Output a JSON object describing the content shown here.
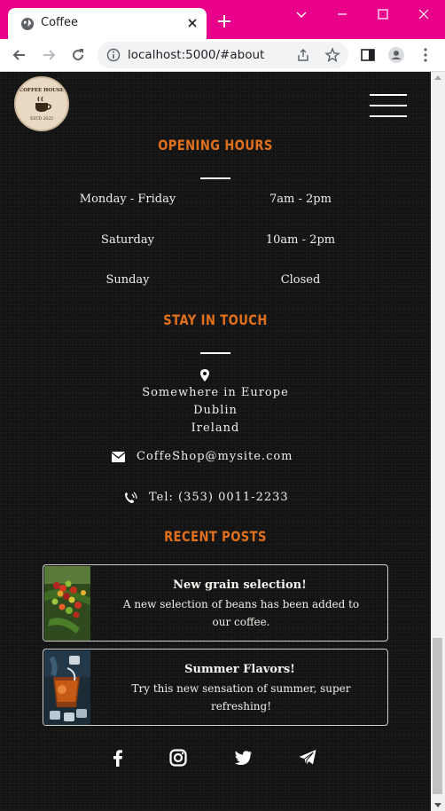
{
  "browser": {
    "tab_title": "Coffee",
    "url": "localhost:5000/#about"
  },
  "site": {
    "logo_top_text": "COFFEE HOUSE",
    "logo_bottom_text": "ESTD 2023"
  },
  "opening_hours": {
    "title": "OPENING HOURS",
    "rows": [
      {
        "day": "Monday - Friday",
        "time": "7am - 2pm"
      },
      {
        "day": "Saturday",
        "time": "10am - 2pm"
      },
      {
        "day": "Sunday",
        "time": "Closed"
      }
    ]
  },
  "stay_in_touch": {
    "title": "STAY IN TOUCH",
    "address": [
      "Somewhere in Europe",
      "Dublin",
      "Ireland"
    ],
    "email": "CoffeShop@mysite.com",
    "phone": "Tel: (353) 0011-2233"
  },
  "recent_posts": {
    "title": "RECENT POSTS",
    "posts": [
      {
        "title": "New grain selection!",
        "text_lines": [
          "A new selection of beans has been added to",
          "our coffee."
        ]
      },
      {
        "title": "Summer Flavors!",
        "text_lines": [
          "Try this new sensation of summer, super",
          "refreshing!"
        ]
      }
    ]
  },
  "social_icons": [
    "facebook-icon",
    "instagram-icon",
    "twitter-icon",
    "telegram-icon"
  ],
  "colors": {
    "accent": "#e0701c",
    "page_bg": "#141414",
    "frame": "#e8008a"
  }
}
